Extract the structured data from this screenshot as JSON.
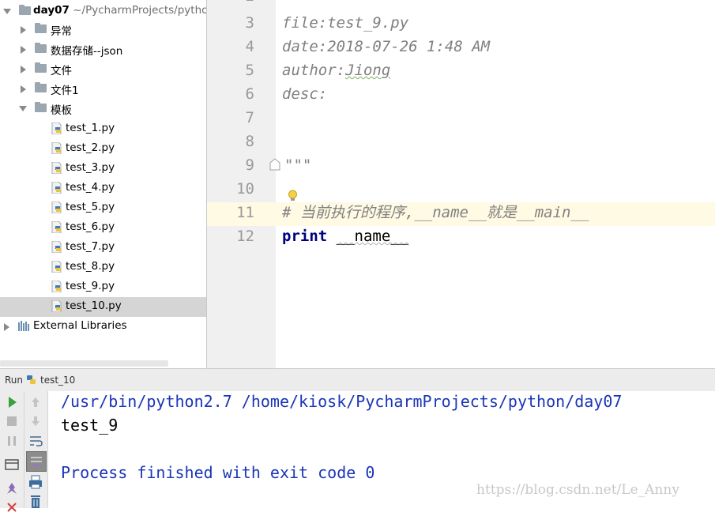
{
  "project_tree": {
    "root_name": "day07",
    "root_path": "~/PycharmProjects/pytho",
    "folders": [
      {
        "label": "异常"
      },
      {
        "label": "数据存储--json"
      },
      {
        "label": "文件"
      },
      {
        "label": "文件1"
      },
      {
        "label": "模板"
      }
    ],
    "files": [
      {
        "label": "test_1.py"
      },
      {
        "label": "test_2.py"
      },
      {
        "label": "test_3.py"
      },
      {
        "label": "test_4.py"
      },
      {
        "label": "test_5.py"
      },
      {
        "label": "test_6.py"
      },
      {
        "label": "test_7.py"
      },
      {
        "label": "test_8.py"
      },
      {
        "label": "test_9.py"
      },
      {
        "label": "test_10.py"
      }
    ],
    "external_libraries": "External Libraries"
  },
  "editor": {
    "line_numbers": [
      "3",
      "4",
      "5",
      "6",
      "7",
      "8",
      "9",
      "10",
      "11",
      "12"
    ],
    "doc_file": "file:test_9.py",
    "doc_date": "date:2018-07-26 1:48 AM",
    "doc_author_key": "author:",
    "doc_author_val": "Jiong",
    "doc_desc": "desc:",
    "doc_close": "\"\"\"",
    "comment_line": "# 当前执行的程序,__name__就是__main__",
    "print_kw": "print",
    "print_arg": "__name__"
  },
  "run_panel": {
    "run_label": "Run",
    "config_name": "test_10",
    "console_lines": {
      "command": "/usr/bin/python2.7 /home/kiosk/PycharmProjects/python/day07",
      "output": "test_9",
      "finished": "Process finished with exit code 0"
    }
  },
  "watermark": "https://blog.csdn.net/Le_Anny",
  "colors": {
    "selection": "#d5d5d5",
    "caret_line": "#fffae3",
    "console_blue": "#1a35b8",
    "keyword": "#000080",
    "comment": "#808080"
  }
}
